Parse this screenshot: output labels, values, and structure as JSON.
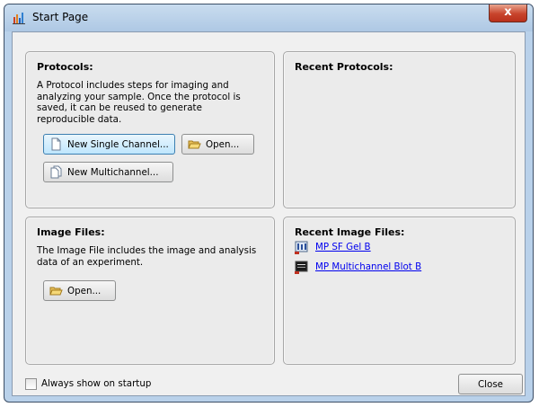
{
  "window": {
    "title": "Start Page",
    "close_glyph": "x"
  },
  "protocols": {
    "title": "Protocols:",
    "description_lines": [
      "A Protocol includes steps for imaging and",
      "analyzing your sample. Once the protocol is",
      "saved, it can be reused to generate",
      "reproducible data."
    ],
    "new_single_label": "New Single Channel...",
    "open_label": "Open...",
    "new_multi_label": "New Multichannel..."
  },
  "recent_protocols": {
    "title": "Recent Protocols:"
  },
  "image_files": {
    "title": "Image Files:",
    "description_lines": [
      "The Image File includes the image and analysis",
      "data of an experiment."
    ],
    "open_label": "Open..."
  },
  "recent_image_files": {
    "title": "Recent Image Files:",
    "files": [
      {
        "label": "MP SF Gel B",
        "icon": "gel-image-icon"
      },
      {
        "label": "MP Multichannel Blot B",
        "icon": "blot-image-icon"
      }
    ]
  },
  "footer": {
    "always_show_label": "Always show on startup",
    "always_show_checked": false,
    "close_label": "Close"
  },
  "colors": {
    "window_frame": "#b9d1ea",
    "close_button": "#c8442c",
    "link": "#0000ee"
  }
}
